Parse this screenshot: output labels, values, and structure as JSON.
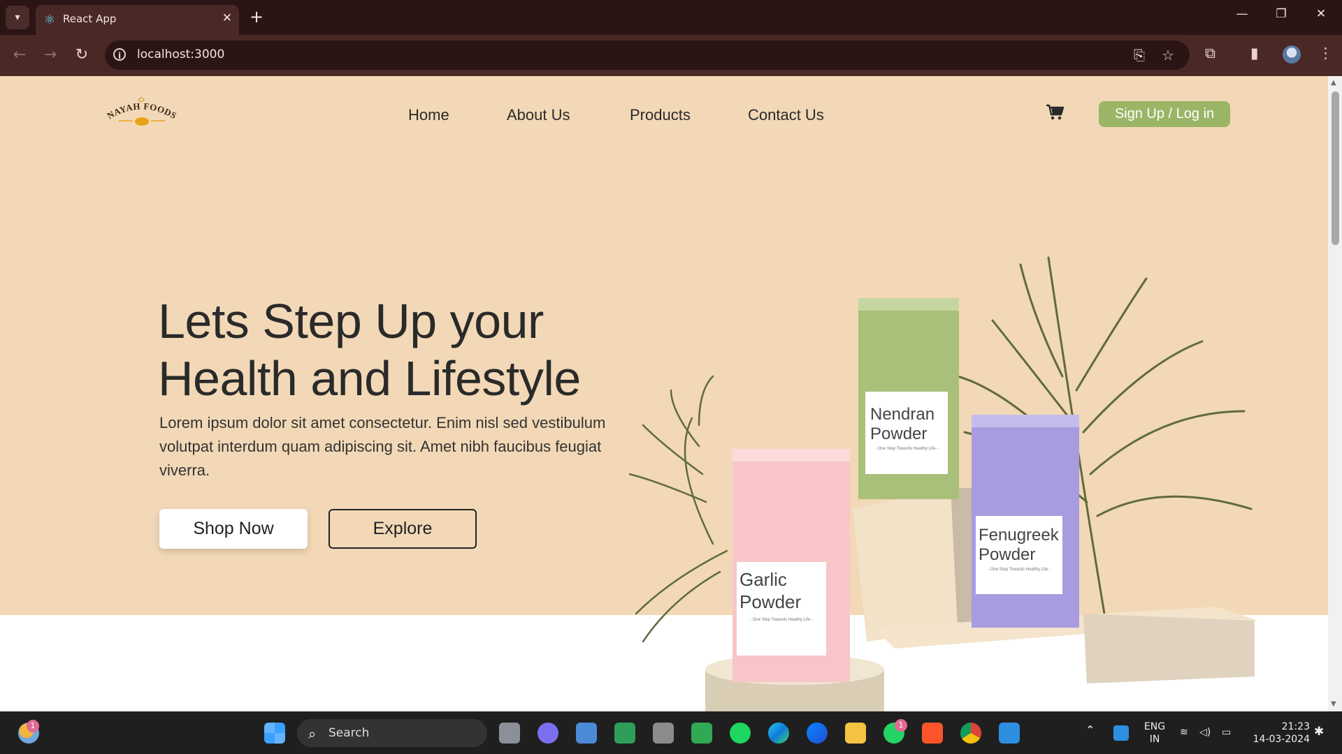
{
  "browser": {
    "tab_title": "React App",
    "url": "localhost:3000"
  },
  "site": {
    "nav": [
      {
        "label": "Home"
      },
      {
        "label": "About Us"
      },
      {
        "label": "Products"
      },
      {
        "label": "Contact Us"
      }
    ],
    "auth_button": "Sign Up / Log in",
    "logo_text": "NAYAH FOODS",
    "hero": {
      "headline_line1": "Lets Step Up your",
      "headline_line2": "Health and Lifestyle",
      "lead": "Lorem ipsum dolor sit amet consectetur. Enim nisl sed vestibulum volutpat interdum quam adipiscing sit. Amet nibh faucibus feugiat viverra.",
      "primary_cta": "Shop Now",
      "secondary_cta": "Explore"
    },
    "products": [
      {
        "name_line1": "Garlic",
        "name_line2": "Powder",
        "tagline": "- One Step Towards Healthy Life -",
        "color": "#f8c6c8"
      },
      {
        "name_line1": "Nendran",
        "name_line2": "Powder",
        "tagline": "- One Step Towards Healthy Life -",
        "color": "#a9c07a"
      },
      {
        "name_line1": "Fenugreek",
        "name_line2": "Powder",
        "tagline": "- One Step Towards Healthy Life -",
        "color": "#a89be0"
      }
    ],
    "colors": {
      "hero_bg": "#f2d8b6",
      "accent_green": "#9ab566",
      "text_dark": "#2a2a2a"
    }
  },
  "taskbar": {
    "search_label": "Search",
    "weather_badge": "1",
    "whatsapp_badge": "1",
    "lang_line1": "ENG",
    "lang_line2": "IN",
    "time": "21:23",
    "date": "14-03-2024"
  }
}
